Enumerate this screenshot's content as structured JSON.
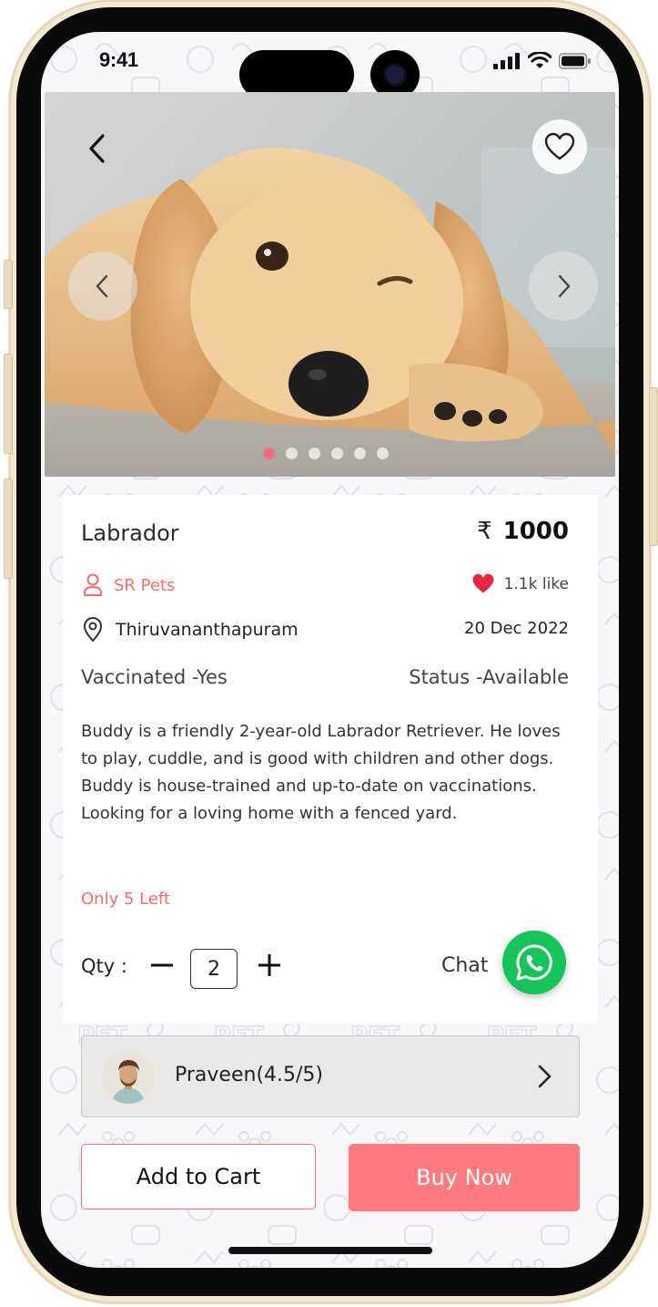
{
  "status_bar": {
    "time": "9:41"
  },
  "listing": {
    "name": "Labrador",
    "currency_symbol": "₹",
    "price": "1000",
    "seller": "SR Pets",
    "likes": "1.1k like",
    "location": "Thiruvananthapuram",
    "date": "20 Dec 2022",
    "vaccinated": "Vaccinated -Yes",
    "status": "Status -Available",
    "description": "Buddy is a friendly 2-year-old Labrador Retriever. He loves to play, cuddle, and is good with children and other dogs. Buddy is house-trained and up-to-date on vaccinations. Looking for a loving home with a fenced yard.",
    "stock_note": "Only 5 Left"
  },
  "gallery": {
    "image_count": 6,
    "active_index": 0
  },
  "quantity": {
    "label": "Qty :",
    "value": "2"
  },
  "chat": {
    "label": "Chat"
  },
  "seller_card": {
    "name": "Praveen(4.5/5)"
  },
  "actions": {
    "add_to_cart": "Add to Cart",
    "buy_now": "Buy Now"
  },
  "colors": {
    "accent": "#ff6b7d",
    "whatsapp": "#14c35a",
    "buy_button": "#ff7a80"
  }
}
